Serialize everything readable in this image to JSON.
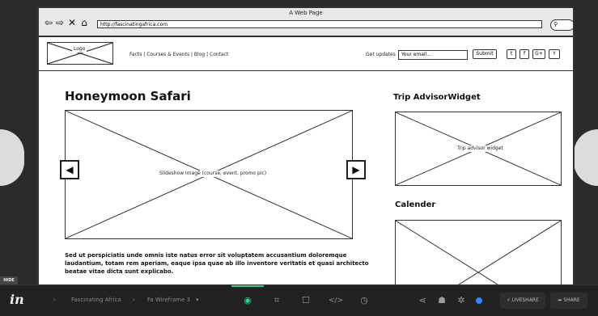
{
  "window": {
    "title": "A Web Page",
    "url": "http://fascinatingafrica.com"
  },
  "header": {
    "logo": "Logo",
    "nav": "Facts | Courses & Events | Blog | Contact",
    "updates_label": "Get updates",
    "email_placeholder": "Your email...",
    "submit": "Submit",
    "social": [
      "t",
      "f",
      "G+",
      "Y"
    ]
  },
  "main": {
    "title": "Honeymoon Safari",
    "slideshow_caption": "Slideshow image (course, event, promo pic)",
    "paragraph": "Sed ut perspiciatis unde omnis iste natus error sit voluptatem accusantium doloremque laudantium, totam rem aperiam, eaque ipsa quae ab illo inventore veritatis et quasi architecto beatae vitae dicta sunt explicabo."
  },
  "sidebar": {
    "widget_title": "Trip AdvisorWidget",
    "widget_caption": "Trip advisor widget",
    "calendar_title": "Calender"
  },
  "viewer": {
    "hide_label": "HIDE",
    "project": "Fascinating Africa",
    "screen": "Fa Wireframe 3",
    "liveshare": "LIVESHARE",
    "share": "SHARE",
    "accent": "#2bd18b",
    "status_dot": "#2f8bff",
    "icons": [
      "eye-icon",
      "crop-icon",
      "comment-icon",
      "code-icon",
      "history-icon",
      "share-nodes-icon",
      "inspect-icon",
      "settings-icon"
    ]
  }
}
